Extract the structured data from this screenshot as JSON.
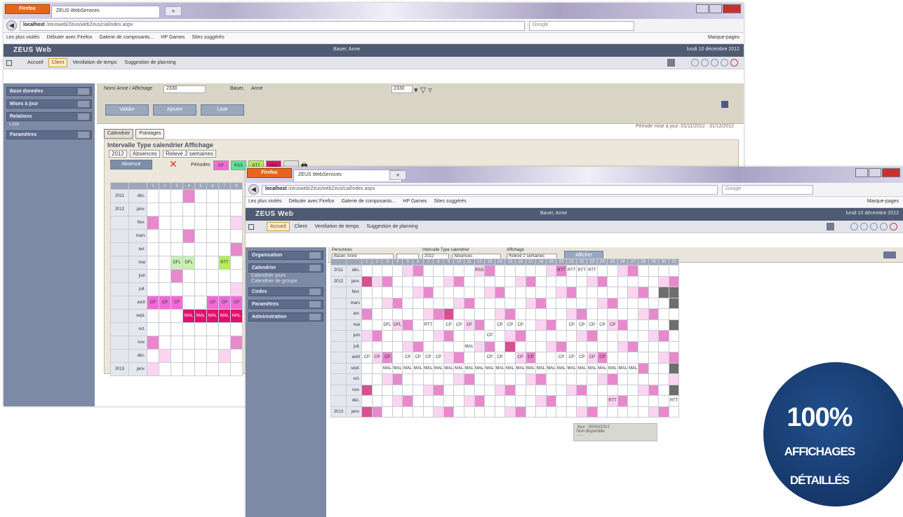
{
  "browser": {
    "firefox_label": "Firefox",
    "tab_title": "ZEUS WebServices",
    "new_tab": "+",
    "back": "◀",
    "url_host": "localhost",
    "url_path": "/zeusweb/Zeus/webZeus/cal/index.aspx",
    "search_placeholder": "Google",
    "bookmarks": [
      "Les plus visités",
      "Débuter avec Firefox",
      "Galerie de composants...",
      "HP Games",
      "Sites suggérés"
    ],
    "bookmarks_right": "Marque-pages"
  },
  "app": {
    "logo": "ZEUS Web",
    "user": "Bauer, Anne",
    "date": "lundi 10 décembre 2012",
    "menu": [
      "Accueil",
      "Client",
      "Ventilation de temps",
      "Suggestion de planning"
    ]
  },
  "window1": {
    "sidebar": [
      {
        "label": "Base données",
        "subs": []
      },
      {
        "label": "Mises à jour",
        "subs": []
      },
      {
        "label": "Relations",
        "subs": [
          "Liste"
        ]
      },
      {
        "label": "Paramètres",
        "subs": []
      }
    ],
    "filter_left": "Nom/ Anne / Affichage",
    "filter_code": "2330",
    "filter_name_label": "Bauer,",
    "filter_name": "Anne",
    "filter_code2": "2330",
    "buttons": [
      "Valider",
      "Ajouter",
      "Liste"
    ],
    "period": "Période mise à jour: 01/11/2012 - 31/12/2012",
    "tabs": [
      "Calendrier",
      "Pointages"
    ],
    "panel_title": "Intervalle Type calendrier Affichage",
    "panel_selects": [
      "2012",
      "Absences",
      "Relevé 2 semaines"
    ],
    "absence_btn": "Absence",
    "periods_label": "Périodes",
    "legend": [
      {
        "label": "CP",
        "color": "#f06bd6"
      },
      {
        "label": "RSS",
        "color": "#5fe39a"
      },
      {
        "label": "RTT",
        "color": "#b5ee5a"
      },
      {
        "label": "MAL",
        "color": "#e0116d"
      },
      {
        "label": "",
        "color": "#e0e0e0"
      }
    ],
    "cal_headers": [
      "",
      "",
      "1",
      "2",
      "3",
      "4",
      "5",
      "6",
      "7",
      "8"
    ],
    "cal_rows": [
      {
        "year": "2011",
        "month": "déc.",
        "cells": [
          "",
          "",
          "",
          "p",
          "",
          "",
          "",
          ""
        ]
      },
      {
        "year": "2012",
        "month": "janv.",
        "cells": [
          "",
          "",
          "",
          "",
          "",
          "",
          "",
          ""
        ]
      },
      {
        "year": "",
        "month": "févr.",
        "cells": [
          "p",
          "",
          "",
          "",
          "",
          "",
          "",
          "l"
        ]
      },
      {
        "year": "",
        "month": "mars",
        "cells": [
          "",
          "",
          "",
          "p",
          "",
          "",
          "",
          ""
        ]
      },
      {
        "year": "",
        "month": "avr.",
        "cells": [
          "",
          "",
          "",
          "",
          "",
          "",
          "",
          "p"
        ]
      },
      {
        "year": "",
        "month": "mai",
        "cells": [
          "",
          "",
          "DFL",
          "DFL",
          "",
          "",
          "RTT",
          ""
        ]
      },
      {
        "year": "",
        "month": "juin",
        "cells": [
          "",
          "",
          "p",
          "",
          "",
          "",
          "",
          ""
        ]
      },
      {
        "year": "",
        "month": "juil.",
        "cells": [
          "",
          "",
          "",
          "",
          "",
          "",
          "",
          "l"
        ]
      },
      {
        "year": "",
        "month": "août",
        "cells": [
          "CP",
          "CP",
          "CP",
          "",
          "",
          "CP",
          "CP",
          "CP"
        ]
      },
      {
        "year": "",
        "month": "sept.",
        "cells": [
          "",
          "",
          "",
          "MAL",
          "MAL",
          "MAL",
          "MAL",
          "MAL"
        ]
      },
      {
        "year": "",
        "month": "oct.",
        "cells": [
          "",
          "",
          "",
          "",
          "",
          "",
          "",
          ""
        ]
      },
      {
        "year": "",
        "month": "nov.",
        "cells": [
          "p",
          "",
          "",
          "",
          "",
          "",
          "",
          "p"
        ]
      },
      {
        "year": "",
        "month": "déc.",
        "cells": [
          "",
          "l",
          "",
          "",
          "",
          "",
          "l",
          ""
        ]
      },
      {
        "year": "2013",
        "month": "janv.",
        "cells": [
          "l",
          "",
          "",
          "",
          "",
          "",
          "",
          ""
        ]
      }
    ]
  },
  "window2": {
    "sidebar": [
      {
        "label": "Organisation",
        "subs": []
      },
      {
        "label": "Calendrier",
        "subs": [
          "Calendrier jours",
          "Calendrier de groupe"
        ]
      },
      {
        "label": "Codes",
        "subs": []
      },
      {
        "label": "Paramètres",
        "subs": []
      },
      {
        "label": "Administration",
        "subs": []
      }
    ],
    "filter_labels": [
      "Personnes",
      "Intervalle Type calendrier",
      "Affichage"
    ],
    "filter_values": [
      "Bauer, Anne",
      "2012",
      "Absences",
      "Relevé 2 semaines"
    ],
    "afficher": "Afficher",
    "day_count": 31,
    "months": [
      {
        "year": "2011",
        "month": "déc."
      },
      {
        "year": "2012",
        "month": "janv."
      },
      {
        "year": "",
        "month": "févr."
      },
      {
        "year": "",
        "month": "mars"
      },
      {
        "year": "",
        "month": "avr."
      },
      {
        "year": "",
        "month": "mai"
      },
      {
        "year": "",
        "month": "juin"
      },
      {
        "year": "",
        "month": "juil."
      },
      {
        "year": "",
        "month": "août"
      },
      {
        "year": "",
        "month": "sept."
      },
      {
        "year": "",
        "month": "oct."
      },
      {
        "year": "",
        "month": "nov."
      },
      {
        "year": "",
        "month": "déc."
      },
      {
        "year": "2013",
        "month": "janv."
      }
    ],
    "tooltip_lines": [
      "Jour : 00/00/2012",
      "Non disponible",
      "- - -"
    ]
  },
  "badge": {
    "percent": "100%",
    "line1": "AFFICHAGES",
    "line2": "DÉTAILLÉS"
  },
  "colors": {
    "cp": "#f06bd6",
    "rss": "#5fe39a",
    "rtt": "#b5ee5a",
    "mal": "#e0116d",
    "weekend_light": "#fbd4f0",
    "weekend_dark": "#e889cc",
    "holiday_pink": "#d5528f",
    "gray_block": "#6e6e6e"
  }
}
